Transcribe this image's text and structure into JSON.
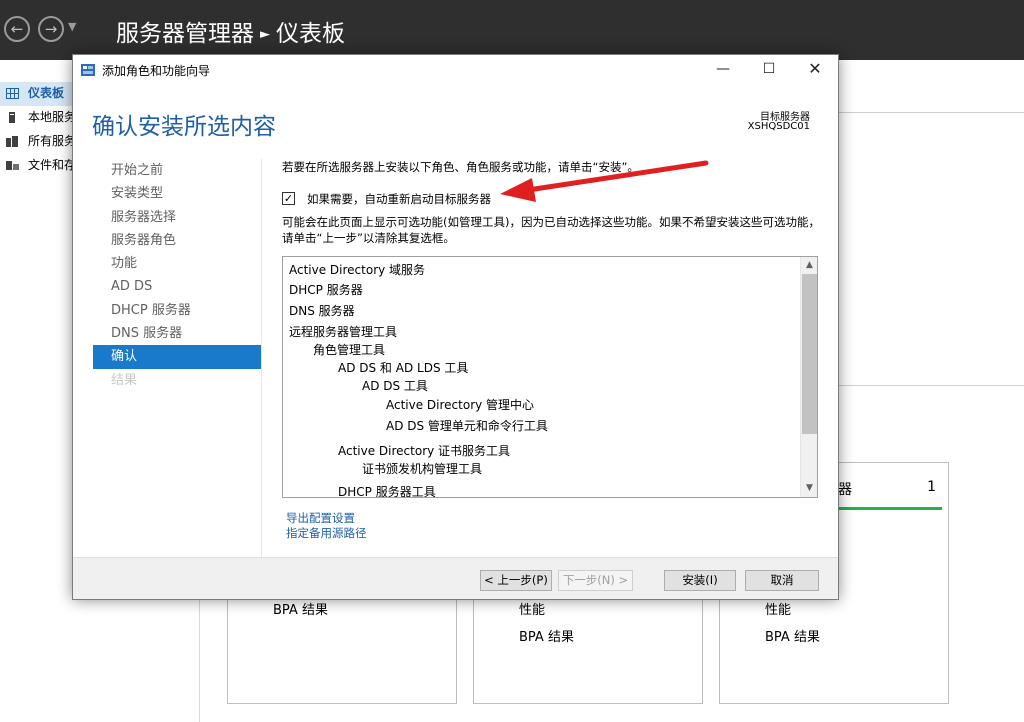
{
  "server_manager": {
    "title_app": "服务器管理器",
    "title_page": "仪表板",
    "sidebar": [
      {
        "label": "仪表板",
        "icon": "dashboard-icon",
        "active": true
      },
      {
        "label": "本地服务器",
        "icon": "server-icon"
      },
      {
        "label": "所有服务器",
        "icon": "servers-icon"
      },
      {
        "label": "文件和存储服务",
        "icon": "storage-icon"
      }
    ],
    "tiles": [
      {
        "lines": [
          "BPA 结果"
        ]
      },
      {
        "lines": [
          "性能",
          "BPA 结果"
        ]
      },
      {
        "name": "器",
        "count": "1",
        "lines": [
          "性能",
          "BPA 结果"
        ],
        "status_color": "#22b14c"
      }
    ]
  },
  "dialog": {
    "title": "添加角色和功能向导",
    "heading": "确认安装所选内容",
    "target_label": "目标服务器",
    "target_value": "XSHQSDC01",
    "steps": [
      {
        "label": "开始之前",
        "state": "normal"
      },
      {
        "label": "安装类型",
        "state": "normal"
      },
      {
        "label": "服务器选择",
        "state": "normal"
      },
      {
        "label": "服务器角色",
        "state": "normal"
      },
      {
        "label": "功能",
        "state": "normal"
      },
      {
        "label": "AD DS",
        "state": "normal"
      },
      {
        "label": "DHCP 服务器",
        "state": "normal"
      },
      {
        "label": "DNS 服务器",
        "state": "normal"
      },
      {
        "label": "确认",
        "state": "active"
      },
      {
        "label": "结果",
        "state": "disabled"
      }
    ],
    "intro_text": "若要在所选服务器上安装以下角色、角色服务或功能，请单击“安装”。",
    "restart_checkbox": {
      "label": "如果需要，自动重新启动目标服务器",
      "checked": true
    },
    "note_text": "可能会在此页面上显示可选功能(如管理工具)，因为已自动选择这些功能。如果不希望安装这些可选功能，请单击“上一步”以清除其复选框。",
    "features": [
      {
        "text": "Active Directory 域服务",
        "level": 0
      },
      {
        "text": "DHCP 服务器",
        "level": 0
      },
      {
        "text": "DNS 服务器",
        "level": 0
      },
      {
        "text": "远程服务器管理工具",
        "level": 0
      },
      {
        "text": "角色管理工具",
        "level": 1
      },
      {
        "text": "AD DS 和 AD LDS 工具",
        "level": 2
      },
      {
        "text": "AD DS 工具",
        "level": 3
      },
      {
        "text": "Active Directory 管理中心",
        "level": 4
      },
      {
        "text": "AD DS 管理单元和命令行工具",
        "level": 4
      },
      {
        "text": "Active Directory 证书服务工具",
        "level": 2
      },
      {
        "text": "证书颁发机构管理工具",
        "level": 3
      },
      {
        "text": "DHCP 服务器工具",
        "level": 2
      }
    ],
    "links": {
      "export": "导出配置设置",
      "alt_source": "指定备用源路径"
    },
    "buttons": {
      "prev": "< 上一步(P)",
      "next": "下一步(N) >",
      "install": "安装(I)",
      "cancel": "取消"
    },
    "accent_color": "#1979ca",
    "annotation_arrow_color": "#e02020"
  }
}
